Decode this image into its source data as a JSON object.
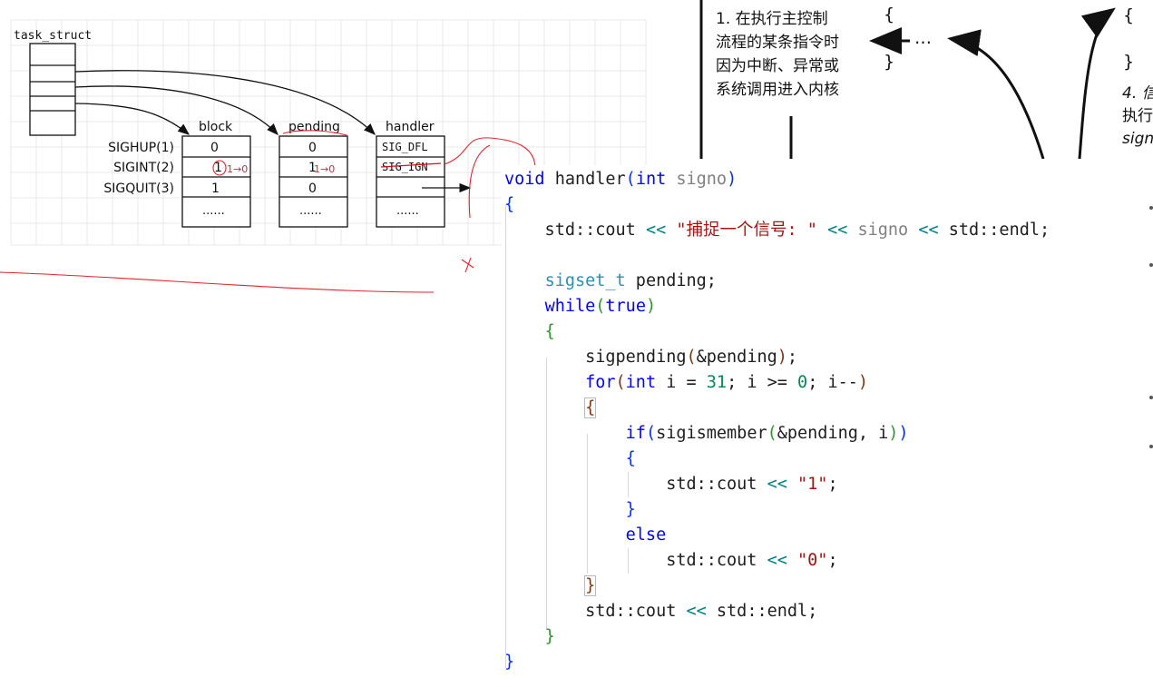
{
  "diagram": {
    "task_struct_label": "task_struct",
    "columns": {
      "block": "block",
      "pending": "pending",
      "handler": "handler"
    },
    "signals": [
      "SIGHUP(1)",
      "SIGINT(2)",
      "SIGQUIT(3)"
    ],
    "block_values": [
      "0",
      "1",
      "1"
    ],
    "pending_values": [
      "0",
      "1",
      "0"
    ],
    "handler_values": [
      "SIG_DFL",
      "SIG_IGN",
      ""
    ],
    "ellipsis": "......",
    "annotation_block": "1→0",
    "annotation_pending": "1→0"
  },
  "flow": {
    "step1_lines": [
      "1. 在执行主控制",
      "流程的某条指令时",
      "因为中断、异常或",
      "系统调用进入内核"
    ],
    "brace_open": "{",
    "brace_close": "}",
    "dots": "…",
    "step4_lines": [
      "4. 信",
      "执行",
      "sign"
    ]
  },
  "code": {
    "lines": [
      "void handler(int signo)",
      "{",
      "    std::cout << \"捕捉一个信号: \" << signo << std::endl;",
      "",
      "    sigset_t pending;",
      "    while(true)",
      "    {",
      "        sigpending(&pending);",
      "        for(int i = 31; i >= 0; i--)",
      "        {",
      "            if(sigismember(&pending, i))",
      "            {",
      "                std::cout << \"1\";",
      "            }",
      "            else",
      "                std::cout << \"0\";",
      "        }",
      "        std::cout << std::endl;",
      "    }",
      "}"
    ]
  }
}
